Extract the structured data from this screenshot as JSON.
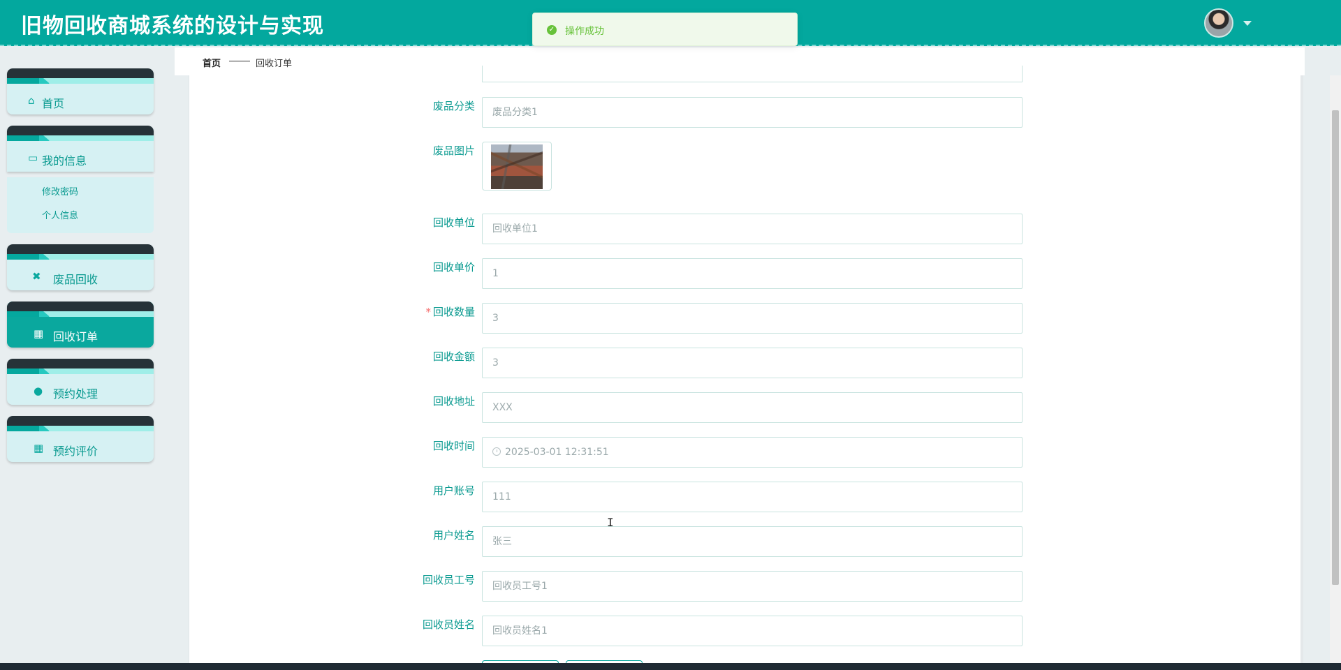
{
  "header": {
    "title": "旧物回收商城系统的设计与实现",
    "avatar_icon": "user-avatar"
  },
  "toast": {
    "icon": "check-circle-icon",
    "message": "操作成功",
    "color": "#67c23a"
  },
  "breadcrumb": {
    "home": "首页",
    "current": "回收订单"
  },
  "sidebar": {
    "items": [
      {
        "label": "首页",
        "icon": "home-icon"
      },
      {
        "label": "我的信息",
        "icon": "id-card-icon",
        "children": [
          "修改密码",
          "个人信息"
        ]
      },
      {
        "label": "废品回收",
        "icon": "ticket-icon"
      },
      {
        "label": "回收订单",
        "icon": "grid-icon",
        "active": true
      },
      {
        "label": "预约处理",
        "icon": "lightbulb-icon"
      },
      {
        "label": "预约评价",
        "icon": "grid-icon"
      }
    ],
    "accent_color": "#0aa89e"
  },
  "form": {
    "fields": [
      {
        "label": "废品分类",
        "value": "废品分类1"
      },
      {
        "label": "废品图片",
        "type": "image"
      },
      {
        "label": "回收单位",
        "value": "回收单位1"
      },
      {
        "label": "回收单价",
        "value": "1"
      },
      {
        "label": "回收数量",
        "value": "3",
        "required": true
      },
      {
        "label": "回收金额",
        "value": "3"
      },
      {
        "label": "回收地址",
        "value": "XXX"
      },
      {
        "label": "回收时间",
        "value": "2025-03-01 12:31:51",
        "icon": "clock-icon"
      },
      {
        "label": "用户账号",
        "value": "111"
      },
      {
        "label": "用户姓名",
        "value": "张三"
      },
      {
        "label": "回收员工号",
        "value": "回收员工号1"
      },
      {
        "label": "回收员姓名",
        "value": "回收员姓名1"
      }
    ]
  }
}
